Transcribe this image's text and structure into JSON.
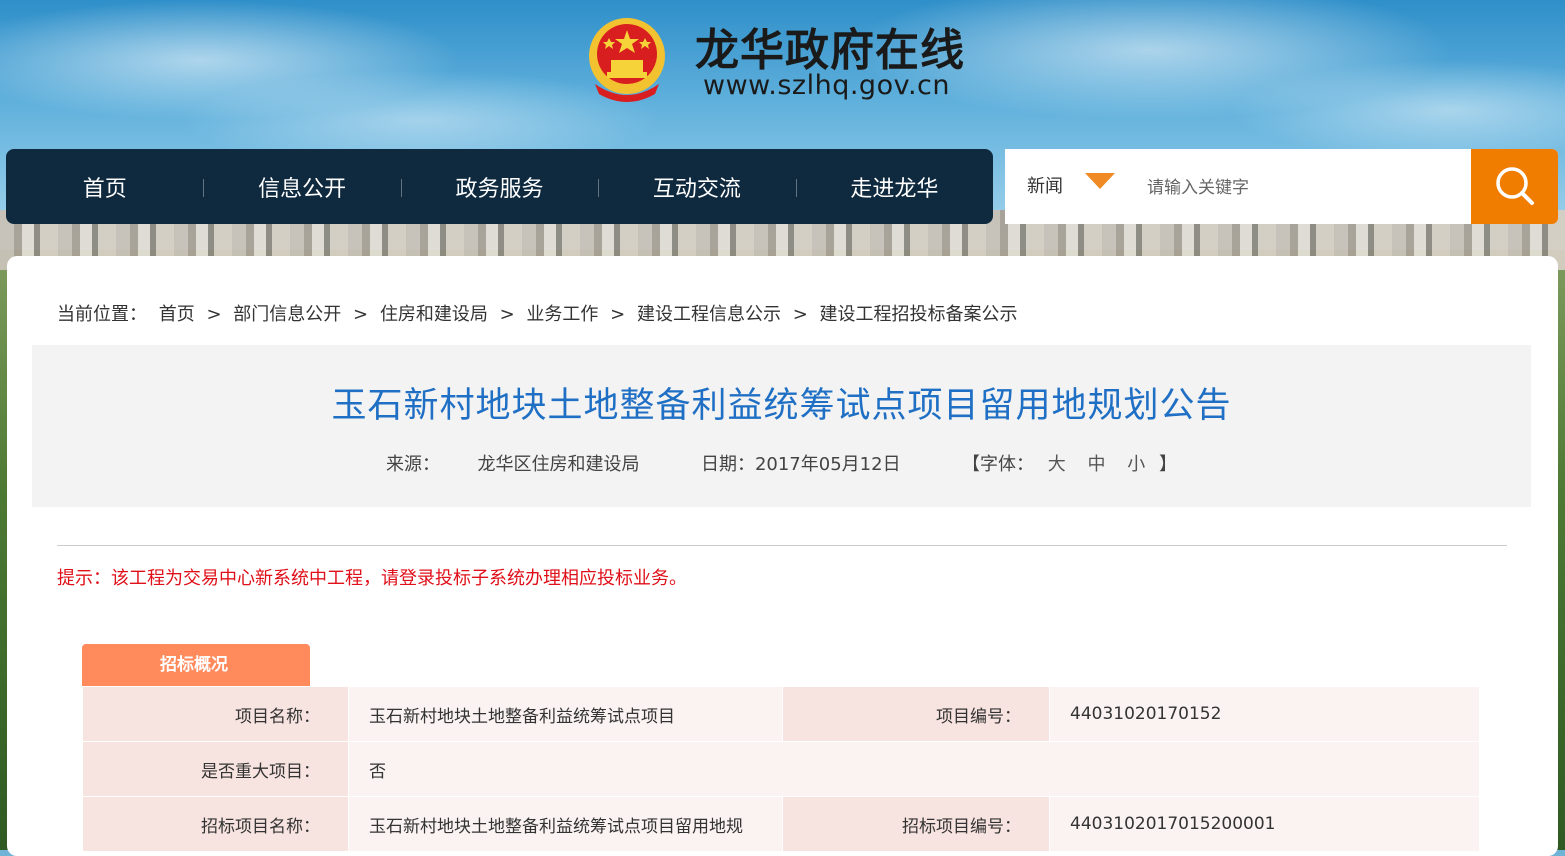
{
  "header": {
    "site_title": "龙华政府在线",
    "site_url": "www.szlhq.gov.cn"
  },
  "nav": {
    "items": [
      "首页",
      "信息公开",
      "政务服务",
      "互动交流",
      "走进龙华"
    ]
  },
  "search": {
    "category": "新闻",
    "placeholder": "请输入关键字"
  },
  "breadcrumb": {
    "prefix": "当前位置：",
    "items": [
      "首页",
      "部门信息公开",
      "住房和建设局",
      "业务工作",
      "建设工程信息公示",
      "建设工程招投标备案公示"
    ],
    "separator": ">"
  },
  "article": {
    "title": "玉石新村地块土地整备利益统筹试点项目留用地规划公告",
    "source_label": "来源：",
    "source": "龙华区住房和建设局",
    "date_label": "日期：",
    "date": "2017年05月12日",
    "font_label": "【字体：",
    "font_sizes": [
      "大",
      "中",
      "小"
    ],
    "font_close": "】"
  },
  "tip": "提示：该工程为交易中心新系统中工程，请登录投标子系统办理相应投标业务。",
  "section": {
    "tab_label": "招标概况",
    "rows": [
      {
        "label1": "项目名称：",
        "value1": "玉石新村地块土地整备利益统筹试点项目",
        "label2": "项目编号：",
        "value2": "44031020170152"
      },
      {
        "label1": "是否重大项目：",
        "value1": "否"
      },
      {
        "label1": "招标项目名称：",
        "value1": "玉石新村地块土地整备利益统筹试点项目留用地规",
        "label2": "招标项目编号：",
        "value2": "4403102017015200001"
      }
    ]
  },
  "colors": {
    "nav_bg": "#0f2a3f",
    "search_button": "#f07d00",
    "title_blue": "#1f6fc5",
    "tip_red": "#e0101a",
    "tab_orange": "#ff8a5c"
  }
}
